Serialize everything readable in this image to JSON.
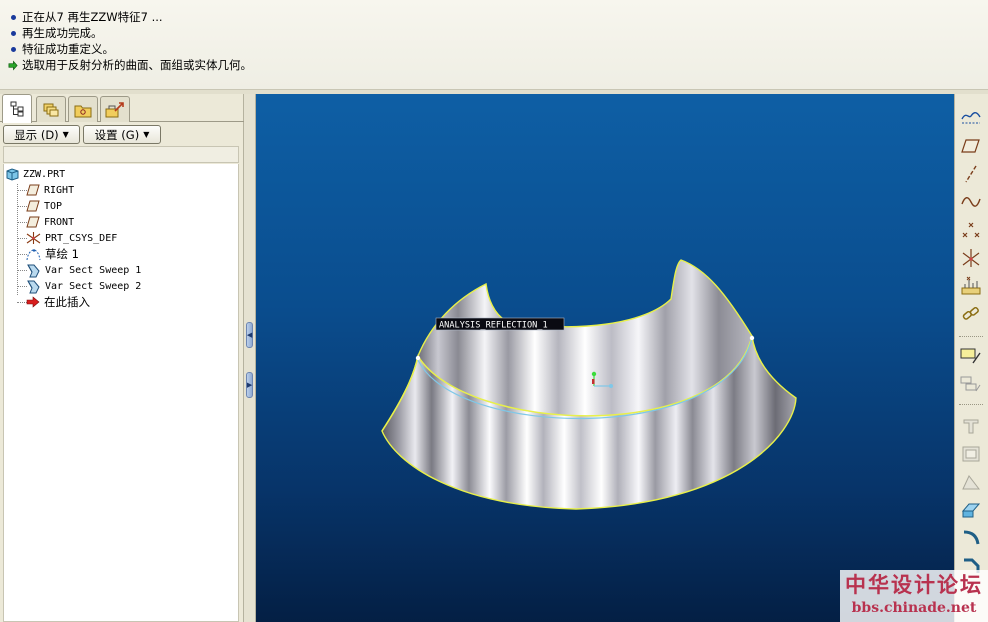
{
  "messages": [
    {
      "icon": "bullet",
      "text": "正在从7 再生ZZW特征7 ..."
    },
    {
      "icon": "bullet",
      "text": "再生成功完成。"
    },
    {
      "icon": "bullet",
      "text": "特征成功重定义。"
    },
    {
      "icon": "arrow-prompt",
      "text": "选取用于反射分析的曲面、面组或实体几何。"
    }
  ],
  "panel": {
    "tabs": [
      {
        "name": "model-tree",
        "icon": "model-tree-icon"
      },
      {
        "name": "layers",
        "icon": "layers-icon"
      },
      {
        "name": "folder-browser",
        "icon": "folder-icon"
      },
      {
        "name": "favorites",
        "icon": "toolbox-icon"
      }
    ],
    "show_label": "显示 (D)",
    "settings_label": "设置 (G)"
  },
  "tree": {
    "root": "ZZW.PRT",
    "items": [
      {
        "label": "RIGHT",
        "icon": "datum-plane-icon"
      },
      {
        "label": "TOP",
        "icon": "datum-plane-icon"
      },
      {
        "label": "FRONT",
        "icon": "datum-plane-icon"
      },
      {
        "label": "PRT_CSYS_DEF",
        "icon": "csys-icon"
      },
      {
        "label": "草绘 1",
        "icon": "sketch-icon"
      },
      {
        "label": "Var Sect Sweep 1",
        "icon": "sweep-feature-icon"
      },
      {
        "label": "Var Sect Sweep 2",
        "icon": "sweep-feature-icon"
      },
      {
        "label": "在此插入",
        "icon": "insert-here-icon"
      }
    ]
  },
  "viewport": {
    "analysis_label": "ANALYSIS_REFLECTION_1"
  },
  "right_toolbar": [
    "datum-display-icon",
    "datum-plane-tool-icon",
    "datum-axis-tool-icon",
    "datum-curve-tool-icon",
    "datum-point-tool-icon",
    "csys-tool-icon",
    "analysis-tool-icon",
    "chain-tool-icon",
    "sketch-tool-icon",
    "feature-tool-icon",
    "hole-tool-icon",
    "shell-tool-icon",
    "draft-tool-icon",
    "rib-tool-icon",
    "round-tool-icon",
    "chamfer-tool-icon"
  ],
  "colors": {
    "viewport_top": "#0e5fa5",
    "viewport_bottom": "#041f44",
    "surface_edge": "#e8f04a",
    "watermark": "#b8324f"
  },
  "watermark": {
    "title": "中华设计论坛",
    "url": "bbs.chinade.net"
  }
}
